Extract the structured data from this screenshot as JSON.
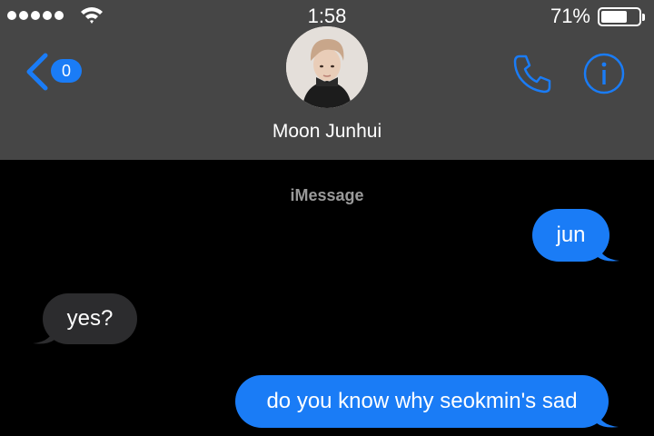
{
  "status_bar": {
    "time": "1:58",
    "battery_percent": "71%",
    "battery_level": 0.71,
    "signal_bars": 5
  },
  "nav": {
    "back_count": "0",
    "contact_name": "Moon Junhui",
    "avatar_icon": "contact-photo",
    "call_icon": "phone-icon",
    "info_icon": "info-icon"
  },
  "conversation": {
    "service_label": "iMessage",
    "messages": [
      {
        "direction": "sent",
        "text": "jun"
      },
      {
        "direction": "received",
        "text": "yes?"
      },
      {
        "direction": "sent",
        "text": "do you know why seokmin's sad"
      }
    ]
  },
  "colors": {
    "accent": "#1a7cf6",
    "header_bg": "#464646",
    "background": "#000000",
    "received_bubble": "#2c2c2e"
  }
}
